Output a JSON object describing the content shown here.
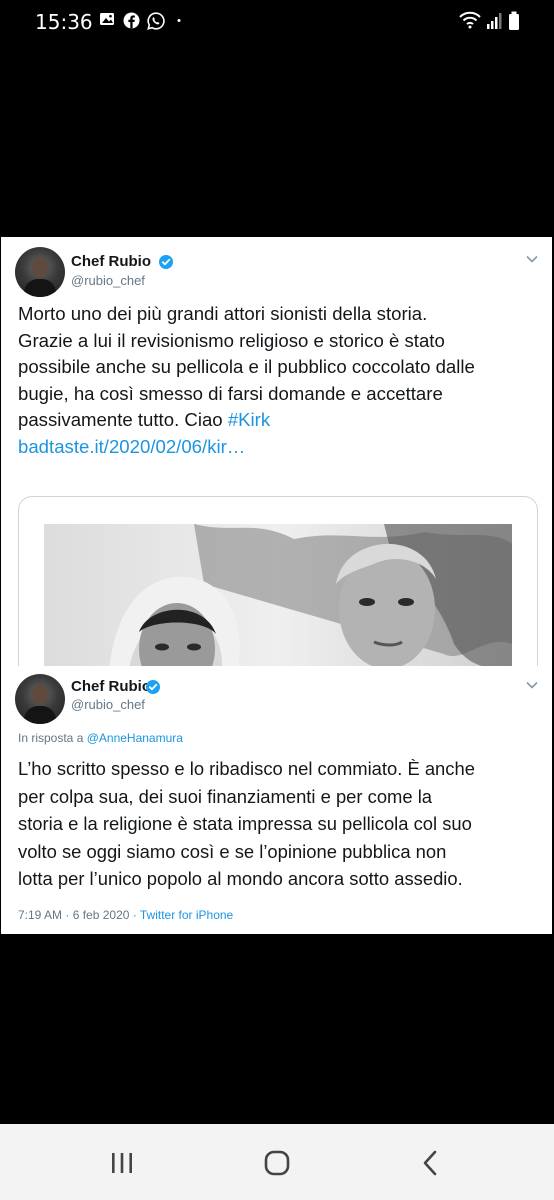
{
  "status_bar": {
    "time": "15:36",
    "left_icons": [
      "gallery-icon",
      "facebook-icon",
      "whatsapp-icon",
      "more-dots-icon"
    ],
    "right_icons": [
      "wifi-icon",
      "signal-icon",
      "battery-icon"
    ]
  },
  "tweet1": {
    "author_name": "Chef Rubio",
    "author_handle": "@rubio_chef",
    "text_lines": [
      "Morto uno dei più grandi attori sionisti della storia.",
      "Grazie a lui il revisionismo religioso e storico è stato",
      "possibile anche su pellicola e il pubblico coccolato dalle",
      "bugie, ha così smesso di farsi domande e accettare"
    ],
    "last_line_text": "passivamente tutto. Ciao ",
    "hashtag": "#Kirk",
    "link": "badtaste.it/2020/02/06/kir…"
  },
  "tweet2": {
    "author_name": "Chef Rubio",
    "author_handle": "@rubio_chef",
    "reply_prefix": "In risposta a ",
    "reply_mention": "@AnneHanamura",
    "text_lines": [
      "L’ho scritto spesso e lo ribadisco nel commiato. È anche",
      "per colpa sua, dei suoi finanziamenti e per come la",
      "storia e la religione è stata impressa su pellicola col suo",
      "volto se oggi siamo così e se l’opinione pubblica non",
      "lotta per l’unico popolo al mondo ancora sotto assedio."
    ],
    "timestamp": "7:19 AM · 6 feb 2020 · ",
    "source": "Twitter for iPhone"
  },
  "nav_bar": {
    "buttons": [
      "recent-apps-icon",
      "home-icon",
      "back-icon"
    ]
  },
  "colors": {
    "link_blue": "#1b95e0",
    "verified_blue": "#1da1f2",
    "secondary_text": "#657786",
    "background": "#000000"
  }
}
